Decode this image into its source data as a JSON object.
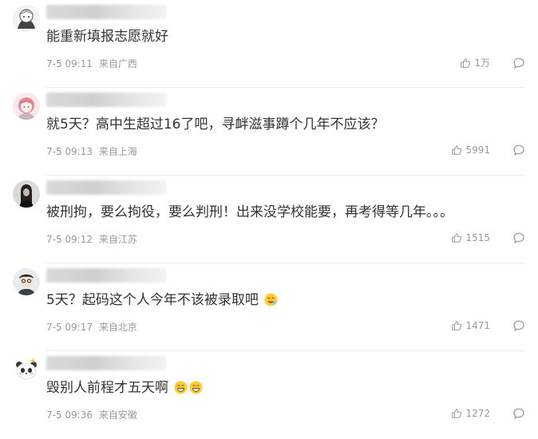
{
  "comments": [
    {
      "username": "用户评论者",
      "avatar_icon": "anime-boy-avatar",
      "content": "能重新填报志愿就好",
      "emojis": [],
      "date": "7-5 09:11",
      "source": "来自广西",
      "likes": "1万"
    },
    {
      "username": "用户评论者",
      "avatar_icon": "anime-girl-avatar",
      "content": "就5天？高中生超过16了吧，寻衅滋事蹲个几年不应该？",
      "emojis": [],
      "date": "7-5 09:13",
      "source": "来自上海",
      "likes": "5991"
    },
    {
      "username": "用户评论者",
      "avatar_icon": "photo-avatar",
      "content": "被刑拘，要么拘役，要么判刑！出来没学校能要，再考得等几年。。。",
      "emojis": [],
      "date": "7-5 09:12",
      "source": "来自江苏",
      "likes": "1515"
    },
    {
      "username": "用户评论者",
      "avatar_icon": "cartoon-avatar",
      "content": "5天？起码这个人今年不该被录取吧",
      "emojis": [
        "drooling-face-emoji"
      ],
      "date": "7-5 09:17",
      "source": "来自北京",
      "likes": "1471"
    },
    {
      "username": "用户评论者",
      "avatar_icon": "panda-avatar",
      "content": "毁别人前程才五天啊",
      "emojis": [
        "grinning-face-emoji",
        "grinning-face-emoji"
      ],
      "date": "7-5 09:36",
      "source": "来自安徽",
      "likes": "1272"
    }
  ],
  "colors": {
    "text": "#333333",
    "meta": "#999999",
    "divider": "#ececec"
  }
}
